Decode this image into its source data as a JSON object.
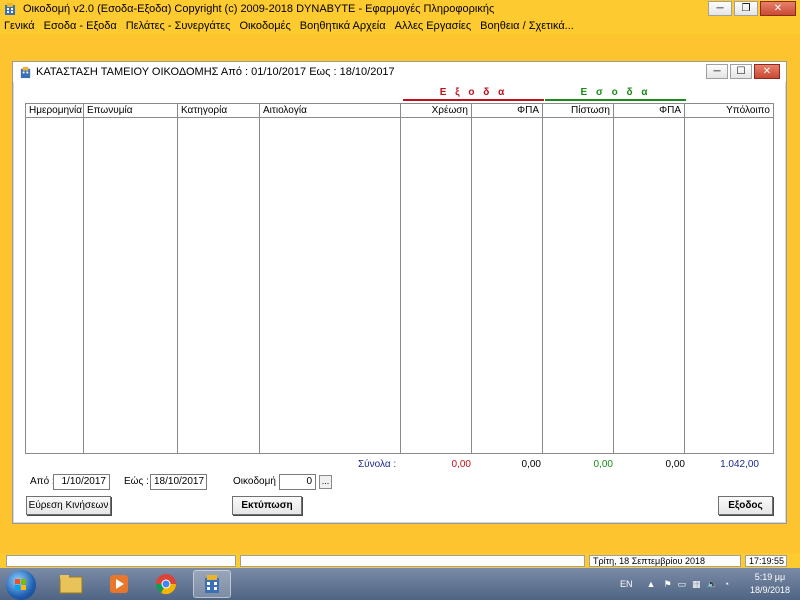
{
  "window": {
    "title": "Οικοδομή v2.0  (Εσοδα-Εξοδα)   Copyright (c) 2009-2018  DYNABYTE - Εφαρμογές Πληροφορικής"
  },
  "menu": {
    "items": [
      "Γενικά",
      "Εσοδα - Εξοδα",
      "Πελάτες - Συνεργάτες",
      "Οικοδομές",
      "Βοηθητικά Αρχεία",
      "Αλλες Εργασίες",
      "Βοηθεια / Σχετικά..."
    ]
  },
  "report": {
    "title": "ΚΑΤΑΣΤΑΣΗ ΤΑΜΕΙΟΥ ΟΙΚΟΔΟΜΗΣ  Από : 01/10/2017  Εως : 18/10/2017",
    "expenses_header": "Ε ξ ο δ α",
    "income_header": "Ε σ ο δ α",
    "columns": [
      "Ημερομηνία",
      "Επωνυμία",
      "Κατηγορία",
      "Αιτιολογία",
      "Χρέωση",
      "ΦΠΑ",
      "Πίστωση",
      "ΦΠΑ",
      "Υπόλοιπο"
    ],
    "totals_label": "Σύνολα :",
    "totals": {
      "charge": "0,00",
      "charge_vat": "0,00",
      "credit": "0,00",
      "credit_vat": "0,00",
      "balance": "1.042,00"
    }
  },
  "filters": {
    "from_label": "Από :",
    "from_value": "1/10/2017",
    "to_label": "Εώς :",
    "to_value": "18/10/2017",
    "building_label": "Οικοδομή :",
    "building_value": "0",
    "lookup_label": "..."
  },
  "buttons": {
    "find": "Εύρεση Κινήσεων",
    "print": "Εκτύπωση",
    "exit": "Εξοδος"
  },
  "statusbar": {
    "date_text": "Τρίτη, 18 Σεπτεμβρίου 2018",
    "time_text": "17:19:55"
  },
  "taskbar": {
    "lang": "EN",
    "time": "5:19 μμ",
    "date": "18/9/2018"
  },
  "colors": {
    "app_bg": "#fec42f",
    "expenses": "#c0101a",
    "income": "#1a8a1a",
    "totals_label": "#1a2a8a"
  }
}
